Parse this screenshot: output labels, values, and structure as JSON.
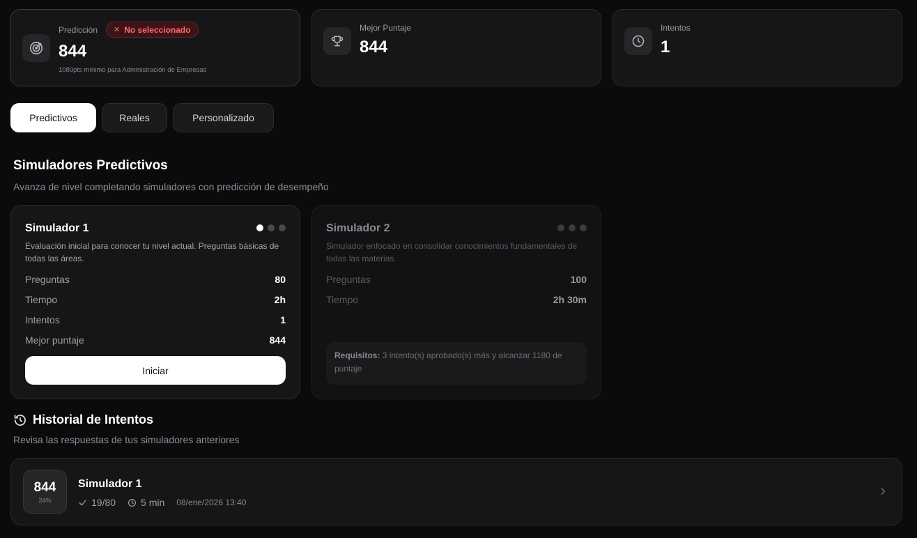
{
  "stats": {
    "prediction": {
      "label": "Predicción",
      "badge": "No seleccionado",
      "value": "844",
      "sub": "1080pts mínimo para Administración de Empresas",
      "icon": "target-icon"
    },
    "best": {
      "label": "Mejor Puntaje",
      "value": "844",
      "icon": "trophy-icon"
    },
    "attempts": {
      "label": "Intentos",
      "value": "1",
      "icon": "clock-icon"
    }
  },
  "tabs": [
    {
      "label": "Predictivos",
      "active": true
    },
    {
      "label": "Reales",
      "active": false
    },
    {
      "label": "Personalizado",
      "active": false
    }
  ],
  "simulators_section": {
    "title": "Simuladores Predictivos",
    "subtitle": "Avanza de nivel completando simuladores con predicción de desempeño"
  },
  "simulators": [
    {
      "title": "Simulador 1",
      "description": "Evaluación inicial para conocer tu nivel actual. Preguntas básicas de todas las áreas.",
      "rows": [
        {
          "k": "Preguntas",
          "v": "80"
        },
        {
          "k": "Tiempo",
          "v": "2h"
        },
        {
          "k": "Intentos",
          "v": "1"
        },
        {
          "k": "Mejor puntaje",
          "v": "844"
        }
      ],
      "button": "Iniciar",
      "dots_active": 1
    },
    {
      "title": "Simulador 2",
      "description": "Simulador enfocado en consolidar conocimientos fundamentales de todas las materias.",
      "rows": [
        {
          "k": "Preguntas",
          "v": "100"
        },
        {
          "k": "Tiempo",
          "v": "2h 30m"
        }
      ],
      "requirements_label": "Requisitos:",
      "requirements_text": "3 intento(s) aprobado(s) más y alcanzar 1180 de puntaje",
      "dots_active": 0
    }
  ],
  "history_section": {
    "title": "Historial de Intentos",
    "subtitle": "Revisa las respuestas de tus simuladores anteriores",
    "icon": "history-icon"
  },
  "history": [
    {
      "score": "844",
      "percent": "24%",
      "name": "Simulador 1",
      "correct": "19/80",
      "duration": "5 min",
      "date": "08/ene/2026 13:40"
    }
  ],
  "colors": {
    "background": "#0b0b0d",
    "card": "#161618",
    "danger": "#ff6b6b",
    "active_tab": "#ffffff"
  }
}
